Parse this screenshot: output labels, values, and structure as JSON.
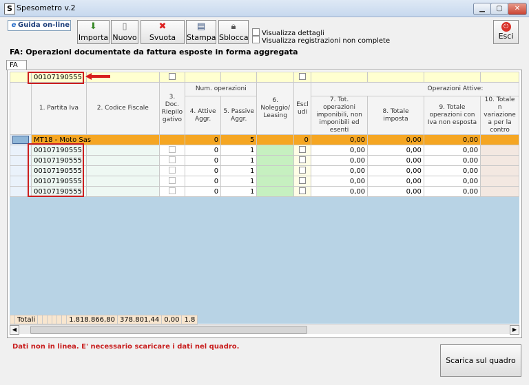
{
  "window": {
    "title": "Spesometro v.2",
    "app_icon_letter": "S"
  },
  "toolbar": {
    "guida_label": "Guida on-line",
    "importa_label": "Importa",
    "nuovo_label": "Nuovo",
    "svuota_label": "Svuota",
    "stampa_label": "Stampa",
    "sblocca_label": "Sblocca",
    "esci_label": "Esci",
    "visualizza_dettagli": "Visualizza dettagli",
    "visualizza_non_complete": "Visualizza registrazioni non complete"
  },
  "section_title": "FA: Operazioni documentate da fattura esposte in forma aggregata",
  "tab_label": "FA",
  "filter_value": "00107190555",
  "headers": {
    "num_operazioni": "Num. operazioni",
    "operazioni_attive": "Operazioni Attive:",
    "col1": "1. Partita Iva",
    "col2": "2. Codice Fiscale",
    "col3": "3. Doc. Riepilo gativo",
    "col4": "4. Attive Aggr.",
    "col5": "5. Passive Aggr.",
    "col6": "6. Noleggio/ Leasing",
    "col_escludi": "Escl udi",
    "col7": "7. Tot. operazioni imponibili, non imponibili ed esenti",
    "col8": "8. Totale imposta",
    "col9": "9. Totale operazioni con Iva non esposta",
    "col10": "10. Totale n variazione a per la contro"
  },
  "group_row": {
    "name": "MT18 - Moto Sas",
    "attive": "0",
    "passive": "5",
    "escludi": "0",
    "tot_op": "0,00",
    "tot_imp": "0,00",
    "tot_iva": "0,00"
  },
  "rows": [
    {
      "piva": "00107190555",
      "attive": "0",
      "passive": "1",
      "tot_op": "0,00",
      "tot_imp": "0,00",
      "tot_iva": "0,00"
    },
    {
      "piva": "00107190555",
      "attive": "0",
      "passive": "1",
      "tot_op": "0,00",
      "tot_imp": "0,00",
      "tot_iva": "0,00"
    },
    {
      "piva": "00107190555",
      "attive": "0",
      "passive": "1",
      "tot_op": "0,00",
      "tot_imp": "0,00",
      "tot_iva": "0,00"
    },
    {
      "piva": "00107190555",
      "attive": "0",
      "passive": "1",
      "tot_op": "0,00",
      "tot_imp": "0,00",
      "tot_iva": "0,00"
    },
    {
      "piva": "00107190555",
      "attive": "0",
      "passive": "1",
      "tot_op": "0,00",
      "tot_imp": "0,00",
      "tot_iva": "0,00"
    }
  ],
  "totals": {
    "label": "Totali",
    "tot_op": "1.818.866,80",
    "tot_imp": "378.801,44",
    "tot_iva": "0,00",
    "col10": "1.8"
  },
  "status_message": "Dati non in linea. E' necessario scaricare i dati nel quadro.",
  "scarica_label": "Scarica sul quadro"
}
